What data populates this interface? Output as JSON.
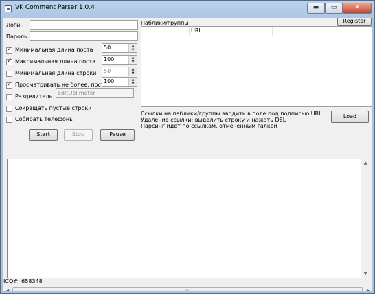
{
  "window": {
    "title": "VK Comment Parser 1.0.4",
    "buttons": {
      "minimize": "▬",
      "maximize": "▭",
      "close": "✕"
    }
  },
  "form": {
    "login_label": "Логин",
    "login_value": "",
    "password_label": "Пароль",
    "password_value": "",
    "options": [
      {
        "label": "Минимальная длина поста",
        "checked": true,
        "value": "50",
        "enabled": true
      },
      {
        "label": "Максимальная длина поста",
        "checked": true,
        "value": "100",
        "enabled": true
      },
      {
        "label": "Минимальная длина строки",
        "checked": false,
        "value": "50",
        "enabled": false
      },
      {
        "label": "Просматривать не более, постов",
        "checked": true,
        "value": "100",
        "enabled": true
      }
    ],
    "delimiter_label": "Разделитель",
    "delimiter_placeholder": "editDelimeter",
    "collapse_empty_label": "Сокращать пустые строки",
    "collect_phones_label": "Собирать телефоны"
  },
  "actions": {
    "start": "Start",
    "stop": "Stop",
    "pause": "Pause",
    "register": "Register",
    "load": "Load"
  },
  "groups": {
    "label": "Паблики/группы",
    "column_url": "URL",
    "help_lines": [
      "Ссылки на паблики/группы вводить в поле под подписью URL",
      "Удаление ссылки: выделить строку и нажать DEL",
      "Парсинг идет по ссылкам, отмеченным галкой"
    ]
  },
  "status": {
    "icq": "ICQ#: 658348"
  },
  "icons": {
    "spin_up": "▲",
    "spin_down": "▼",
    "scroll_up": "▲",
    "scroll_down": "▼",
    "scroll_left": "◄",
    "scroll_right": "►",
    "scroll_grip": "|||"
  }
}
